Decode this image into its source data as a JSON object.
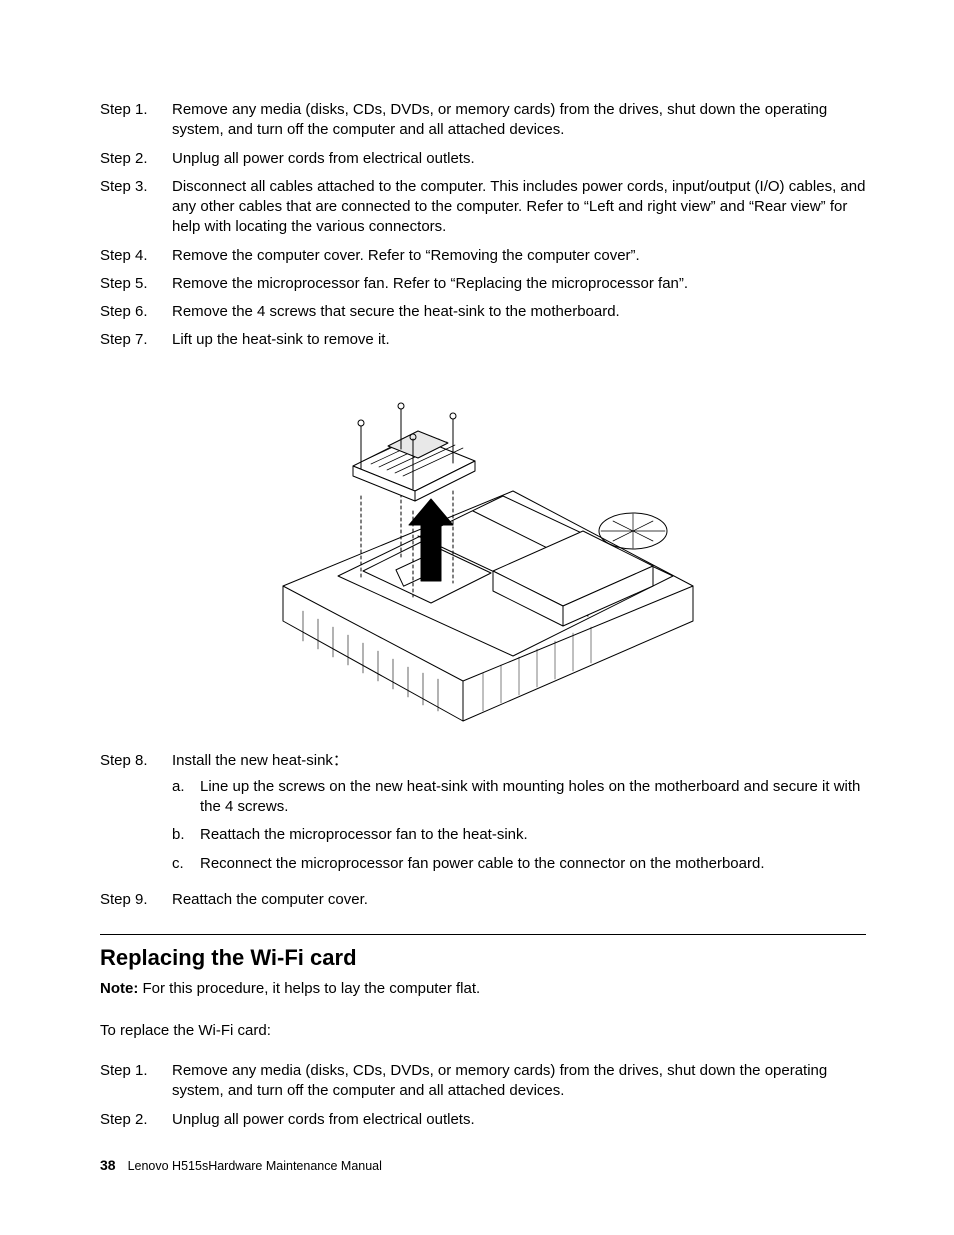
{
  "stepsA": [
    {
      "label": "Step 1.",
      "text": "Remove any media (disks, CDs, DVDs, or memory cards) from the drives, shut down the operating system, and turn off the computer and all attached devices."
    },
    {
      "label": "Step 2.",
      "text": "Unplug all power cords from electrical outlets."
    },
    {
      "label": "Step 3.",
      "text": "Disconnect all cables attached to the computer. This includes power cords, input/output (I/O) cables, and any other cables that are connected to the computer. Refer to “Left and right view” and “Rear view” for help with locating the various connectors."
    },
    {
      "label": "Step 4.",
      "text": "Remove the computer cover. Refer to “Removing the computer cover”."
    },
    {
      "label": "Step 5.",
      "text": "Remove the microprocessor fan. Refer to “Replacing the microprocessor fan”."
    },
    {
      "label": "Step 6.",
      "text": "Remove the 4 screws that secure the heat-sink to the motherboard."
    },
    {
      "label": "Step 7.",
      "text": "Lift up the heat-sink to remove it."
    }
  ],
  "step8": {
    "label": "Step 8.",
    "text": "Install the new heat-sink：",
    "sub": [
      {
        "label": "a.",
        "text": "Line up the screws on the new heat-sink with mounting holes on the motherboard and secure it with the 4 screws."
      },
      {
        "label": "b.",
        "text": "Reattach the microprocessor fan to the heat-sink."
      },
      {
        "label": "c.",
        "text": "Reconnect the microprocessor fan power cable to the connector on the motherboard."
      }
    ]
  },
  "step9": {
    "label": "Step 9.",
    "text": "Reattach the computer cover."
  },
  "section": {
    "title": "Replacing the Wi-Fi card",
    "note_label": "Note:",
    "note_text": " For this procedure, it helps to lay the computer flat.",
    "intro": "To replace the Wi-Fi card:",
    "steps": [
      {
        "label": "Step 1.",
        "text": "Remove any media (disks, CDs, DVDs, or memory cards) from the drives, shut down the operating system, and turn off the computer and all attached devices."
      },
      {
        "label": "Step 2.",
        "text": "Unplug all power cords from electrical outlets."
      }
    ]
  },
  "footer": {
    "page": "38",
    "title": "Lenovo H515sHardware Maintenance Manual"
  }
}
